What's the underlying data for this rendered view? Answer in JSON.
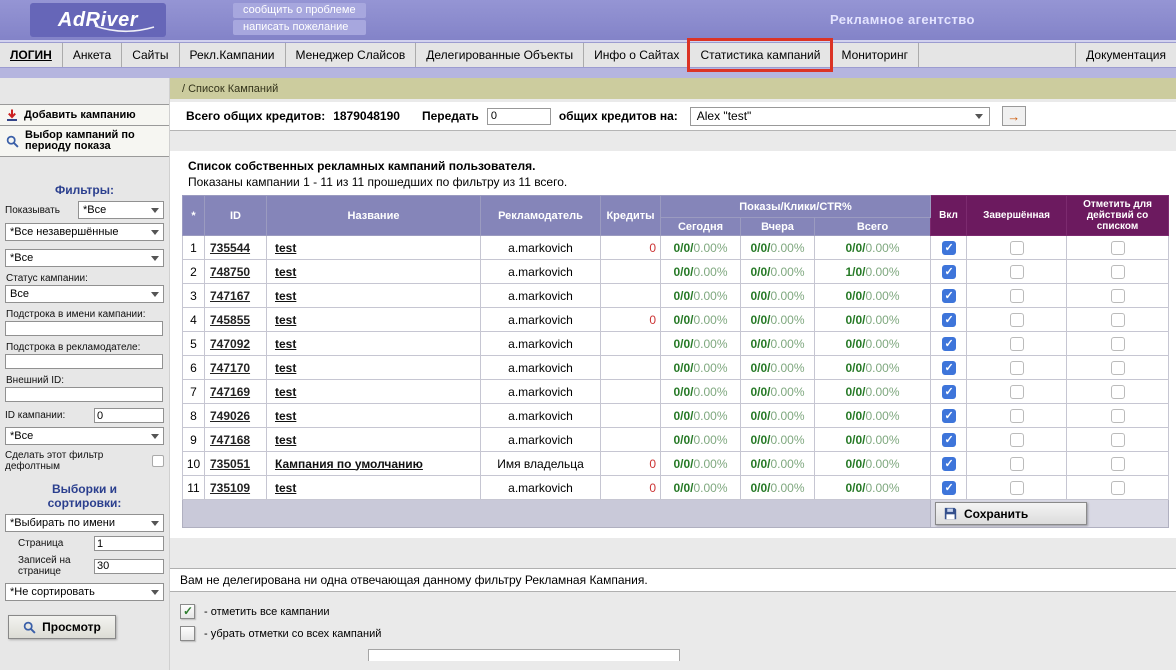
{
  "header": {
    "logo": "AdRiver",
    "report_problem": "сообщить о проблеме",
    "write_wish": "написать пожелание",
    "agency": "Рекламное агентство"
  },
  "nav": {
    "items": [
      "ЛОГИН",
      "Анкета",
      "Сайты",
      "Рекл.Кампании",
      "Менеджер Слайсов",
      "Делегированные Объекты",
      "Инфо о Сайтах",
      "Статистика кампаний",
      "Мониторинг"
    ],
    "right_item": "Документация",
    "highlighted_item": "Статистика кампаний"
  },
  "breadcrumb": "/ Список Кампаний",
  "credits_bar": {
    "total_label": "Всего общих кредитов:",
    "total_value": "1879048190",
    "transfer_label": "Передать",
    "transfer_input": "0",
    "recipient_label": "общих кредитов на:",
    "recipient_value": "Alex \"test\""
  },
  "sidebar": {
    "add_campaign_label": "Добавить кампанию",
    "period_select_label": "Выбор кампаний по периоду показа",
    "filters_title": "Фильтры:",
    "show_label": "Показывать",
    "show_select": "*Все",
    "state_select": "*Все незавершённые",
    "type_select": "*Все",
    "status_label": "Статус кампании:",
    "status_select": "Все",
    "name_substring_label": "Подстрока в имени кампании:",
    "name_substring_value": "",
    "advertiser_substring_label": "Подстрока в рекламодателе:",
    "advertiser_substring_value": "",
    "external_id_label": "Внешний ID:",
    "external_id_value": "",
    "campaign_id_label": "ID кампании:",
    "campaign_id_value": "0",
    "extra_select": "*Все",
    "default_filter_label": "Сделать этот фильтр дефолтным",
    "selections_title": "Выборки и сортировки:",
    "select_by_select": "*Выбирать по имени",
    "page_label": "Страница",
    "page_value": "1",
    "per_page_label": "Записей на странице",
    "per_page_value": "30",
    "sort_select": "*Не сортировать",
    "view_button": "Просмотр"
  },
  "main": {
    "table_title": "Список собственных рекламных кампаний пользователя.",
    "table_subtitle": "Показаны кампании 1 - 11 из 11 прошедших по фильтру из 11 всего.",
    "columns": {
      "star": "*",
      "id": "ID",
      "name": "Название",
      "advertiser": "Рекламодатель",
      "credits": "Кредиты",
      "stats_group": "Показы/Клики/CTR%",
      "today": "Сегодня",
      "yesterday": "Вчера",
      "total": "Всего",
      "enabled": "Вкл",
      "finished": "Завершённая",
      "mark": "Отметить для действий со списком"
    },
    "rows": [
      {
        "num": 1,
        "id": "735544",
        "name": "test",
        "advertiser": "a.markovich",
        "credits": "0",
        "today": "0/0/0.00%",
        "yesterday": "0/0/0.00%",
        "total": "0/0/0.00%",
        "enabled": true,
        "finished": false,
        "marked": false
      },
      {
        "num": 2,
        "id": "748750",
        "name": "test",
        "advertiser": "a.markovich",
        "credits": "",
        "today": "0/0/0.00%",
        "yesterday": "0/0/0.00%",
        "total": "1/0/0.00%",
        "enabled": true,
        "finished": false,
        "marked": false
      },
      {
        "num": 3,
        "id": "747167",
        "name": "test",
        "advertiser": "a.markovich",
        "credits": "",
        "today": "0/0/0.00%",
        "yesterday": "0/0/0.00%",
        "total": "0/0/0.00%",
        "enabled": true,
        "finished": false,
        "marked": false
      },
      {
        "num": 4,
        "id": "745855",
        "name": "test",
        "advertiser": "a.markovich",
        "credits": "0",
        "today": "0/0/0.00%",
        "yesterday": "0/0/0.00%",
        "total": "0/0/0.00%",
        "enabled": true,
        "finished": false,
        "marked": false
      },
      {
        "num": 5,
        "id": "747092",
        "name": "test",
        "advertiser": "a.markovich",
        "credits": "",
        "today": "0/0/0.00%",
        "yesterday": "0/0/0.00%",
        "total": "0/0/0.00%",
        "enabled": true,
        "finished": false,
        "marked": false
      },
      {
        "num": 6,
        "id": "747170",
        "name": "test",
        "advertiser": "a.markovich",
        "credits": "",
        "today": "0/0/0.00%",
        "yesterday": "0/0/0.00%",
        "total": "0/0/0.00%",
        "enabled": true,
        "finished": false,
        "marked": false
      },
      {
        "num": 7,
        "id": "747169",
        "name": "test",
        "advertiser": "a.markovich",
        "credits": "",
        "today": "0/0/0.00%",
        "yesterday": "0/0/0.00%",
        "total": "0/0/0.00%",
        "enabled": true,
        "finished": false,
        "marked": false
      },
      {
        "num": 8,
        "id": "749026",
        "name": "test",
        "advertiser": "a.markovich",
        "credits": "",
        "today": "0/0/0.00%",
        "yesterday": "0/0/0.00%",
        "total": "0/0/0.00%",
        "enabled": true,
        "finished": false,
        "marked": false
      },
      {
        "num": 9,
        "id": "747168",
        "name": "test",
        "advertiser": "a.markovich",
        "credits": "",
        "today": "0/0/0.00%",
        "yesterday": "0/0/0.00%",
        "total": "0/0/0.00%",
        "enabled": true,
        "finished": false,
        "marked": false
      },
      {
        "num": 10,
        "id": "735051",
        "name": "Кампания по умолчанию",
        "advertiser": "Имя владельца",
        "credits": "0",
        "today": "0/0/0.00%",
        "yesterday": "0/0/0.00%",
        "total": "0/0/0.00%",
        "enabled": true,
        "finished": false,
        "marked": false
      },
      {
        "num": 11,
        "id": "735109",
        "name": "test",
        "advertiser": "a.markovich",
        "credits": "0",
        "today": "0/0/0.00%",
        "yesterday": "0/0/0.00%",
        "total": "0/0/0.00%",
        "enabled": true,
        "finished": false,
        "marked": false
      }
    ],
    "save_button": "Сохранить",
    "no_delegated_message": "Вам не делегирована ни одна отвечающая данному фильтру Рекламная Кампания.",
    "legend": [
      {
        "checked": true,
        "label": "- отметить все кампании"
      },
      {
        "checked": false,
        "label": "- убрать отметки со всех кампаний"
      }
    ]
  }
}
